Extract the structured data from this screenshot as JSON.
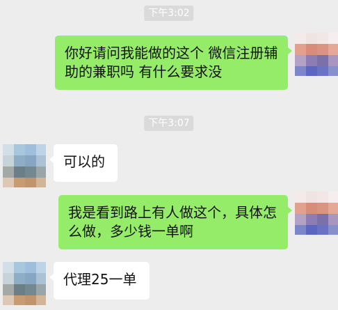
{
  "conversation": {
    "messages": [
      {
        "type": "timestamp",
        "text": "下午3:02"
      },
      {
        "type": "outgoing",
        "text": "你好请问我能做的这个 微信注册辅助的兼职吗 有什么要求没"
      },
      {
        "type": "timestamp",
        "text": "下午3:07"
      },
      {
        "type": "incoming",
        "text": "可以的"
      },
      {
        "type": "outgoing",
        "text": "我是看到路上有人做这个，具体怎么做，多少钱一单啊"
      },
      {
        "type": "incoming",
        "text": "代理25一单"
      }
    ]
  },
  "colors": {
    "background": "#ededed",
    "outgoing_bubble": "#95ec69",
    "incoming_bubble": "#ffffff",
    "timestamp_bg": "#dadada"
  },
  "avatars": {
    "self": "pixelated-avatar",
    "contact": "pixelated-avatar"
  }
}
